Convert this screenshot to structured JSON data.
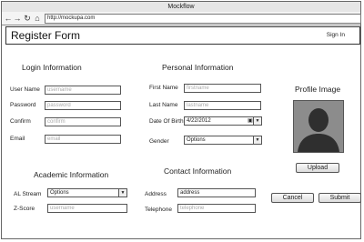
{
  "window": {
    "title": "Mockflow"
  },
  "browser": {
    "url": "http://mockupa.com",
    "icons": {
      "back": "arrow-left-icon",
      "forward": "arrow-right-icon",
      "reload": "reload-icon",
      "home": "home-icon"
    }
  },
  "header": {
    "title": "Register Form",
    "signin": "Sign In"
  },
  "login": {
    "heading": "Login Information",
    "username": {
      "label": "User Name",
      "placeholder": "username"
    },
    "password": {
      "label": "Password",
      "placeholder": "password"
    },
    "confirm": {
      "label": "Confirm",
      "placeholder": "confirm"
    },
    "email": {
      "label": "Email",
      "placeholder": "email"
    }
  },
  "personal": {
    "heading": "Personal Information",
    "firstname": {
      "label": "First Name",
      "placeholder": "firstname"
    },
    "lastname": {
      "label": "Last Name",
      "placeholder": "lastname"
    },
    "dob": {
      "label": "Date Of Birth",
      "value": "4/22/2012"
    },
    "gender": {
      "label": "Gender",
      "value": "Options"
    }
  },
  "profile": {
    "heading": "Profile Image",
    "upload": "Upload"
  },
  "academic": {
    "heading": "Academic Information",
    "stream": {
      "label": "AL Stream",
      "value": "Options"
    },
    "zscore": {
      "label": "Z-Score",
      "placeholder": "username"
    }
  },
  "contact": {
    "heading": "Contact Information",
    "address": {
      "label": "Address",
      "value": "address"
    },
    "telephone": {
      "label": "Telephone",
      "placeholder": "telephone"
    }
  },
  "actions": {
    "cancel": "Cancel",
    "submit": "Submit"
  }
}
